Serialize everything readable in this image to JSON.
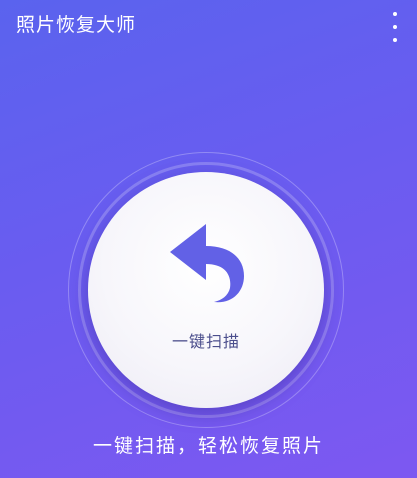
{
  "header": {
    "title": "照片恢复大师",
    "menu_icon": "more-vertical-icon"
  },
  "main": {
    "scan_button_label": "一键扫描",
    "scan_icon": "undo-arrow-icon",
    "tagline": "一键扫描，轻松恢复照片"
  },
  "colors": {
    "background_start": "#5a63ee",
    "background_end": "#7d58f1",
    "icon_color": "#6261e6",
    "label_color": "#4b4e8c"
  }
}
